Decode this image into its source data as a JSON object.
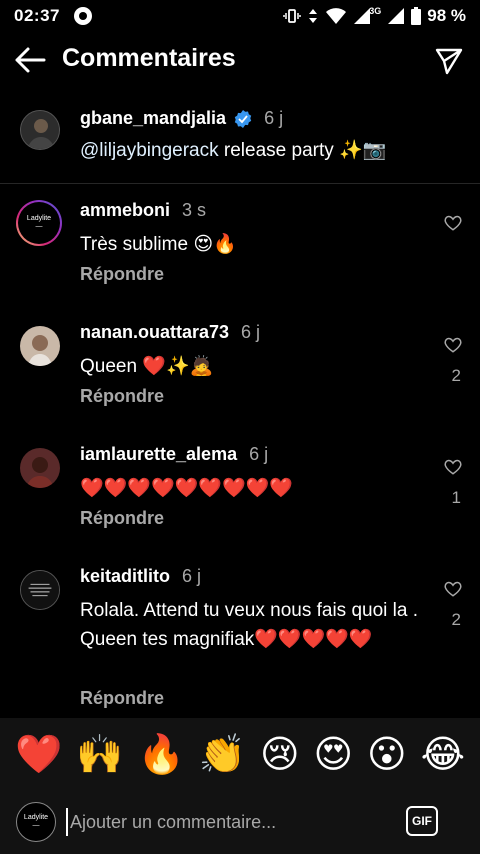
{
  "status": {
    "time": "02:37",
    "battery": "98 %",
    "network_label": "3G"
  },
  "header": {
    "title": "Commentaires"
  },
  "caption": {
    "username": "gbane_mandjalia",
    "age": "6 j",
    "mention": "@liljaybingerack",
    "text": " release party ✨📷"
  },
  "comments": [
    {
      "username": "ammeboni",
      "age": "3 s",
      "text": "Très sublime 😍🔥",
      "likes": "",
      "reply": "Répondre",
      "avatar_text": "Ladylite"
    },
    {
      "username": "nanan.ouattara73",
      "age": "6 j",
      "text": "Queen ❤️✨🙇",
      "likes": "2",
      "reply": "Répondre"
    },
    {
      "username": "iamlaurette_alema",
      "age": "6 j",
      "text": "❤️❤️❤️❤️❤️❤️❤️❤️❤️",
      "likes": "1",
      "reply": "Répondre"
    },
    {
      "username": "keitaditlito",
      "age": "6 j",
      "text": "Rolala. Attend tu veux nous fais quoi la . Queen tes magnifiak❤️❤️❤️❤️❤️",
      "likes": "2",
      "reply": "Répondre"
    }
  ],
  "emoji_bar": [
    "❤️",
    "🙌",
    "🔥",
    "👏",
    "😢",
    "😍",
    "😮",
    "😂"
  ],
  "input": {
    "placeholder": "Ajouter un commentaire...",
    "gif_label": "GIF",
    "avatar_text": "Ladylite"
  }
}
